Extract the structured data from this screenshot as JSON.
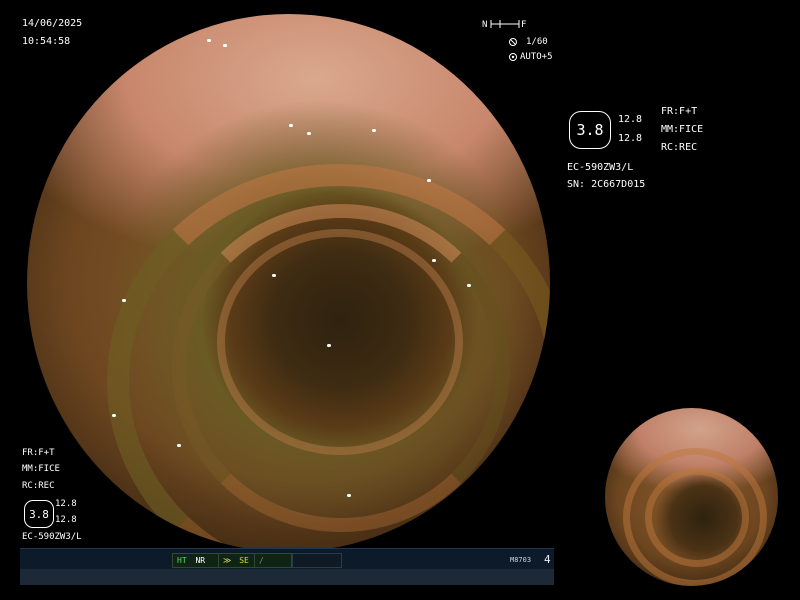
{
  "header": {
    "date": "14/06/2025",
    "time": "10:54:58"
  },
  "focus_indicator": {
    "near_label": "N",
    "far_label": "F",
    "shutter": "1/60",
    "iris_mode": "AUTO+5"
  },
  "right_panel": {
    "gauge_value": "3.8",
    "gauge_top": "12.8",
    "gauge_bottom": "12.8",
    "fr": "FR:F+T",
    "mm": "MM:FICE",
    "rc": "RC:REC",
    "scope_model": "EC-590ZW3/L",
    "serial": "SN: 2C667D015"
  },
  "left_panel": {
    "fr": "FR:F+T",
    "mm": "MM:FICE",
    "rc": "RC:REC",
    "gauge_value": "3.8",
    "gauge_top": "12.8",
    "gauge_bottom": "12.8",
    "scope_model": "EC-590ZW3/L"
  },
  "status_bar": {
    "ht": "HT",
    "nr": "NR",
    "se": "SE",
    "code": "M8703",
    "page": "4"
  },
  "colors": {
    "status_bar_bg": "#0c1a2a",
    "chip_text_green": "#59d659",
    "chip_text_yellow": "#d8d84a"
  }
}
